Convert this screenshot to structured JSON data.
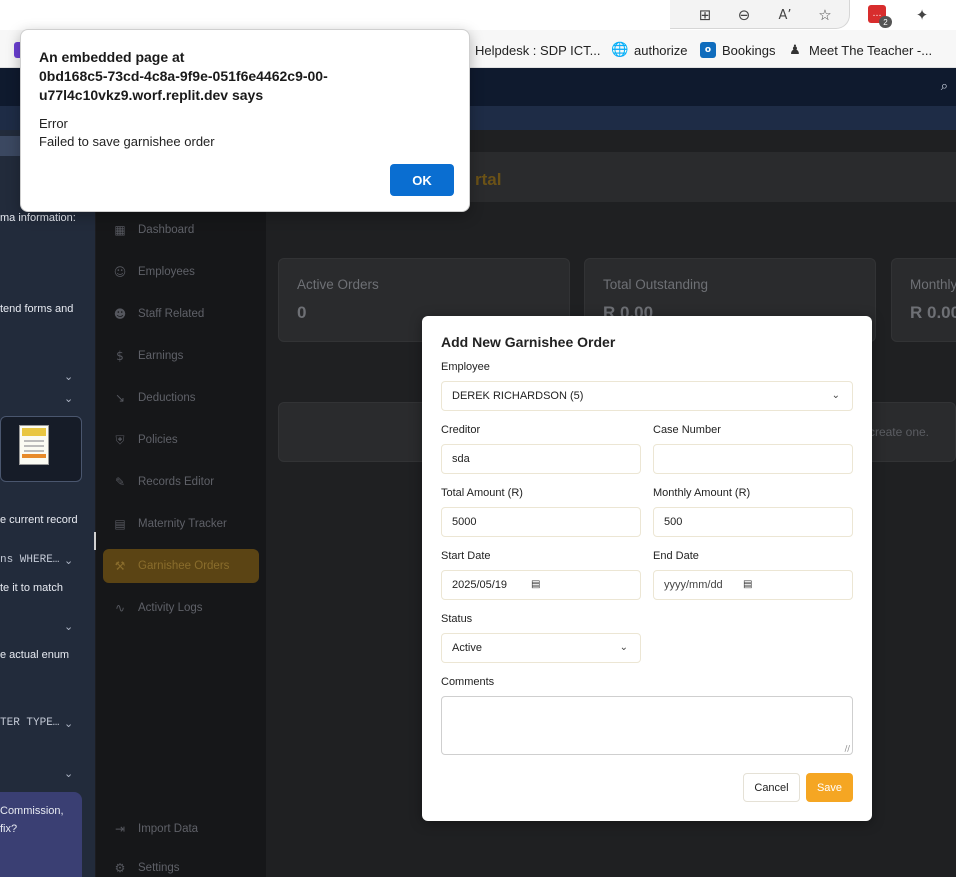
{
  "browser": {
    "toolbar_icons": [
      "grid-plus-icon",
      "zoom-out-icon",
      "read-aloud-icon",
      "favorite-star-icon",
      "extension-icon",
      "puzzle-icon"
    ],
    "extension_badge_count": "2",
    "bookmarks": [
      {
        "label": "Helpdesk : SDP ICT...",
        "icon": "helpdesk-icon",
        "color": "#2e9f4b"
      },
      {
        "label": "authorize",
        "icon": "globe-icon",
        "color": "#555555"
      },
      {
        "label": "Bookings",
        "icon": "outlook-icon",
        "color": "#0f6cbd"
      },
      {
        "label": "Meet The Teacher -...",
        "icon": "person-icon",
        "color": "#333333"
      }
    ]
  },
  "alert": {
    "title_line1": "An embedded page at",
    "title_line2": "0bd168c5-73cd-4c8a-9f9e-051f6e4462c9-00-",
    "title_line3": "u77l4c10vkz9.worf.replit.dev says",
    "message_line1": "Error",
    "message_line2": "Failed to save garnishee order",
    "ok_label": "OK"
  },
  "left_panel": {
    "lines": [
      {
        "text": "ma information:",
        "mono": false
      },
      {
        "text": "tend forms and",
        "mono": false
      },
      {
        "text": "e current record",
        "mono": false
      },
      {
        "text": "ns WHERE…",
        "mono": true
      },
      {
        "text": "te it to match",
        "mono": false
      },
      {
        "text": "e actual enum",
        "mono": false
      },
      {
        "text": "TER TYPE…",
        "mono": true
      },
      {
        "text": "Commission,",
        "mono": false
      },
      {
        "text": "fix?",
        "mono": false
      }
    ]
  },
  "sidebar": {
    "items": [
      {
        "label": "Dashboard",
        "icon": "dashboard-icon"
      },
      {
        "label": "Employees",
        "icon": "users-icon"
      },
      {
        "label": "Staff Related",
        "icon": "user-cog-icon"
      },
      {
        "label": "Earnings",
        "icon": "dollar-icon"
      },
      {
        "label": "Deductions",
        "icon": "trending-down-icon"
      },
      {
        "label": "Policies",
        "icon": "shield-icon"
      },
      {
        "label": "Records Editor",
        "icon": "file-edit-icon"
      },
      {
        "label": "Maternity Tracker",
        "icon": "calendar-icon"
      },
      {
        "label": "Garnishee Orders",
        "icon": "gavel-icon"
      },
      {
        "label": "Activity Logs",
        "icon": "activity-icon"
      }
    ],
    "active_item": "Garnishee Orders",
    "bottom_items": [
      {
        "label": "Import Data",
        "icon": "import-icon"
      },
      {
        "label": "Settings",
        "icon": "settings-icon"
      }
    ]
  },
  "main": {
    "page_title": "rtal",
    "stats": [
      {
        "label": "Active Orders",
        "value": "0"
      },
      {
        "label": "Total Outstanding",
        "value": "R 0.00"
      },
      {
        "label": "Monthly",
        "value": "R 0.00"
      }
    ],
    "empty_text": "create one."
  },
  "modal": {
    "title": "Add New Garnishee Order",
    "employee_label": "Employee",
    "employee_value": "DEREK RICHARDSON (5)",
    "creditor_label": "Creditor",
    "creditor_value": "sda",
    "case_number_label": "Case Number",
    "case_number_value": "",
    "total_amount_label": "Total Amount (R)",
    "total_amount_value": "5000",
    "monthly_amount_label": "Monthly Amount (R)",
    "monthly_amount_value": "500",
    "start_date_label": "Start Date",
    "start_date_value": "2025/05/19",
    "end_date_label": "End Date",
    "end_date_placeholder": "yyyy/mm/dd",
    "status_label": "Status",
    "status_value": "Active",
    "comments_label": "Comments",
    "comments_value": "",
    "cancel_label": "Cancel",
    "save_label": "Save"
  },
  "colors": {
    "accent": "#f5a623",
    "alert_button": "#0a6ed1",
    "app_header": "#0f1a2e"
  }
}
